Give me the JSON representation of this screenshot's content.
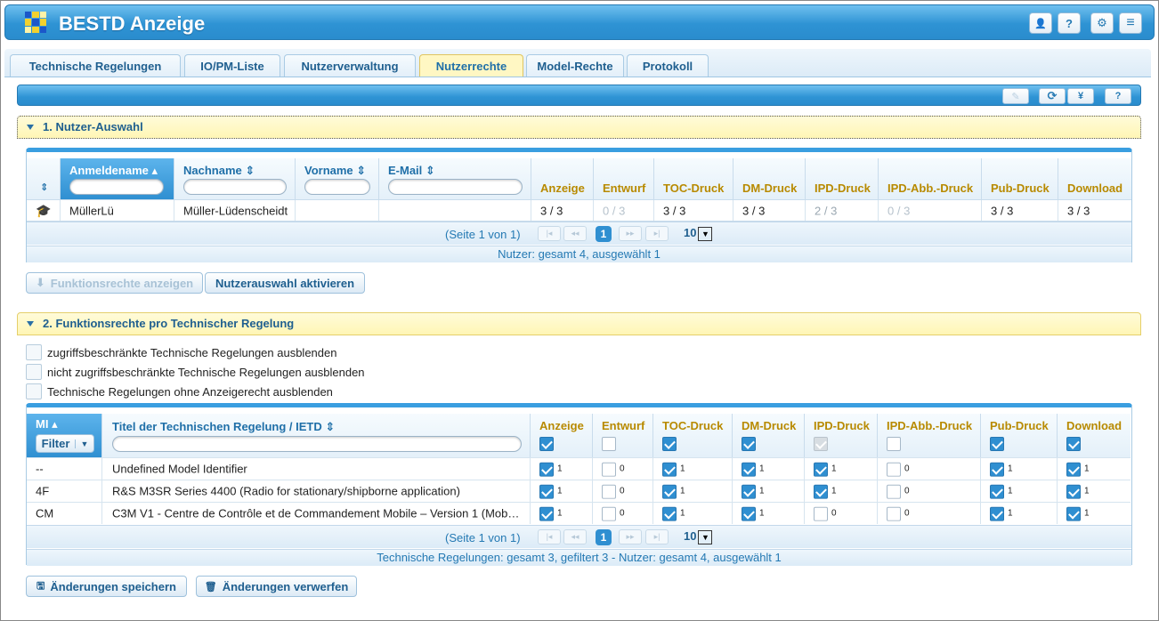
{
  "app": {
    "title": "BESTD Anzeige"
  },
  "header_buttons": [
    {
      "icon": "user-icon",
      "glyph": "👤"
    },
    {
      "icon": "help-icon",
      "glyph": "?"
    },
    {
      "icon": "gear-icon",
      "glyph": "⚙"
    },
    {
      "icon": "menu-icon",
      "glyph": "≡"
    }
  ],
  "tabs": [
    {
      "label": "Technische Regelungen",
      "active": false
    },
    {
      "label": "IO/PM-Liste",
      "active": false
    },
    {
      "label": "Nutzerverwaltung",
      "active": false
    },
    {
      "label": "Nutzerrechte",
      "active": true
    },
    {
      "label": "Model-Rechte",
      "active": false
    },
    {
      "label": "Protokoll",
      "active": false
    }
  ],
  "toolbar": [
    {
      "icon": "edit-icon",
      "glyph": "✎",
      "enabled": false
    },
    {
      "icon": "refresh-icon",
      "glyph": "⟳",
      "enabled": true
    },
    {
      "icon": "yen-icon",
      "glyph": "¥",
      "enabled": true
    },
    {
      "icon": "help-icon",
      "glyph": "?",
      "enabled": true
    }
  ],
  "section1": {
    "title": "1. Nutzer-Auswahl",
    "columns": {
      "anmeldename": "Anmeldename",
      "nachname": "Nachname",
      "vorname": "Vorname",
      "email": "E-Mail",
      "rights": [
        "Anzeige",
        "Entwurf",
        "TOC-Druck",
        "DM-Druck",
        "IPD-Druck",
        "IPD-Abb.-Druck",
        "Pub-Druck",
        "Download"
      ]
    },
    "rows": [
      {
        "anmeldename": "MüllerLü",
        "nachname": "Müller-Lüdenscheidt",
        "vorname": "",
        "email": "",
        "rights": [
          "3 / 3",
          "0 / 3",
          "3 / 3",
          "3 / 3",
          "2 / 3",
          "0 / 3",
          "3 / 3",
          "3 / 3"
        ],
        "dim": [
          false,
          true,
          false,
          false,
          true,
          true,
          false,
          false
        ]
      }
    ],
    "pager": {
      "text": "(Seite 1 von 1)",
      "current": "1",
      "rows_per_page": "10"
    },
    "footer": "Nutzer: gesamt 4, ausgewählt 1",
    "btn_functions": "Funktionsrechte anzeigen",
    "btn_activate": "Nutzerauswahl aktivieren"
  },
  "section2": {
    "title": "2. Funktionsrechte pro Technischer Regelung",
    "options": [
      "zugriffsbeschränkte Technische Regelungen ausblenden",
      "nicht zugriffsbeschränkte Technische Regelungen ausblenden",
      "Technische Regelungen ohne Anzeigerecht ausblenden"
    ],
    "columns": {
      "mi": "MI",
      "filter": "Filter",
      "title": "Titel der Technischen Regelung / IETD",
      "rights": [
        "Anzeige",
        "Entwurf",
        "TOC-Druck",
        "DM-Druck",
        "IPD-Druck",
        "IPD-Abb.-Druck",
        "Pub-Druck",
        "Download"
      ],
      "header_checks": [
        "on",
        "off",
        "on",
        "on",
        "grey",
        "off",
        "on",
        "on"
      ]
    },
    "rows": [
      {
        "mi": "--",
        "title": "Undefined Model Identifier",
        "checks": [
          1,
          0,
          1,
          1,
          1,
          0,
          1,
          1
        ]
      },
      {
        "mi": "4F",
        "title": "R&S M3SR Series 4400 (Radio for stationary/shipborne application)",
        "checks": [
          1,
          0,
          1,
          1,
          1,
          0,
          1,
          1
        ]
      },
      {
        "mi": "CM",
        "title": "C3M V1 - Centre de Contrôle et de Commandement Mobile – Version 1 (Mobil...",
        "checks": [
          1,
          0,
          1,
          1,
          0,
          0,
          1,
          1
        ]
      }
    ],
    "pager": {
      "text": "(Seite 1 von 1)",
      "current": "1",
      "rows_per_page": "10"
    },
    "footer": "Technische Regelungen: gesamt 3, gefiltert 3 - Nutzer: gesamt 4, ausgewählt 1",
    "btn_save": "Änderungen speichern",
    "btn_discard": "Änderungen verwerfen"
  }
}
